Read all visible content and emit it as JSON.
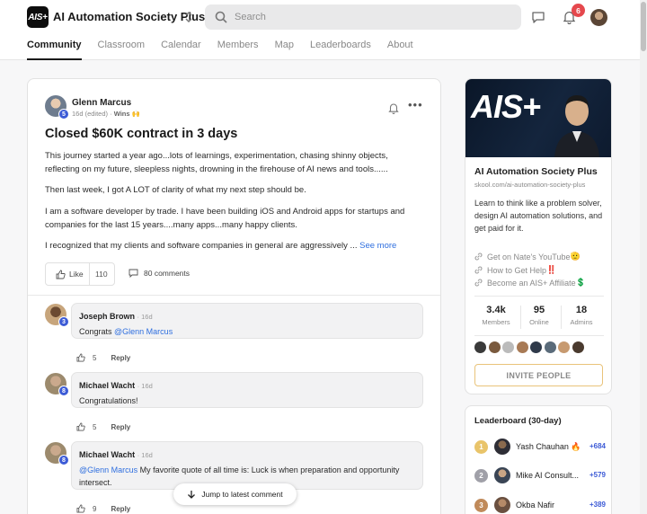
{
  "app": {
    "logo_text": "AIS+",
    "title": "AI Automation Society Plus",
    "search_placeholder": "Search",
    "notification_count": "6"
  },
  "nav": {
    "tabs": [
      {
        "label": "Community",
        "active": true
      },
      {
        "label": "Classroom"
      },
      {
        "label": "Calendar"
      },
      {
        "label": "Members"
      },
      {
        "label": "Map"
      },
      {
        "label": "Leaderboards"
      },
      {
        "label": "About"
      }
    ]
  },
  "post": {
    "author": "Glenn Marcus",
    "author_level": "5",
    "time": "16d (edited) · ",
    "category": "Wins",
    "category_emoji": "🙌",
    "title": "Closed $60K contract in 3 days",
    "paragraphs": [
      "This journey started a year ago...lots of learnings, experimentation, chasing shinny objects, reflecting on my future, sleepless nights, drowning in the firehouse of AI news and tools......",
      "Then last week, I got A LOT of clarity of what my next step should be.",
      "I am a software developer by trade. I have been building iOS and Android apps for startups and companies for the last 15 years....many apps...many happy clients.",
      "I recognized that my clients and software companies in general are aggressively ... "
    ],
    "see_more": "See more",
    "like_label": "Like",
    "like_count": "110",
    "comments_label": "80 comments"
  },
  "comments": [
    {
      "name": "Joseph Brown",
      "time": "· 16d",
      "level": "3",
      "mention": "@Glenn Marcus",
      "text_before": "Congrats ",
      "text_after": "",
      "likes": "5",
      "reply": "Reply"
    },
    {
      "name": "Michael Wacht",
      "time": "· 16d",
      "level": "8",
      "mention": "",
      "text_before": "Congratulations!",
      "text_after": "",
      "likes": "5",
      "reply": "Reply"
    },
    {
      "name": "Michael Wacht",
      "time": "· 16d",
      "level": "8",
      "mention": "@Glenn Marcus",
      "text_before": "",
      "text_after": " My favorite quote of all time is: Luck is when preparation and opportunity intersect.",
      "likes": "9",
      "reply": "Reply"
    }
  ],
  "jump_label": "Jump to latest comment",
  "group": {
    "banner_text": "AIS+",
    "name": "AI Automation Society Plus",
    "url": "skool.com/ai-automation-society-plus",
    "description": "Learn to think like a problem solver, design AI automation solutions, and get paid for it.",
    "links": [
      {
        "label": "Get on Nate's YouTube",
        "emoji": "🫡"
      },
      {
        "label": "How to Get Help",
        "emoji": "‼️"
      },
      {
        "label": "Become an AIS+ Affiliate",
        "emoji": "💲"
      }
    ],
    "stats": [
      {
        "value": "3.4k",
        "label": "Members"
      },
      {
        "value": "95",
        "label": "Online"
      },
      {
        "value": "18",
        "label": "Admins"
      }
    ],
    "invite_label": "INVITE PEOPLE"
  },
  "leaderboard": {
    "title": "Leaderboard (30-day)",
    "rows": [
      {
        "rank": "1",
        "name": "Yash Chauhan",
        "emoji": "🔥",
        "points": "+684",
        "color": "#e9c46a"
      },
      {
        "rank": "2",
        "name": "Mike AI Consult...",
        "emoji": "",
        "points": "+579",
        "color": "#a0a0a8"
      },
      {
        "rank": "3",
        "name": "Okba Nafir",
        "emoji": "",
        "points": "+389",
        "color": "#c08a5a"
      }
    ]
  },
  "colors": {
    "accent_blue": "#2f6fdf",
    "level_badge": "#3c5bd6",
    "notif_red": "#e5484d",
    "invite_border": "#e9c37a"
  }
}
